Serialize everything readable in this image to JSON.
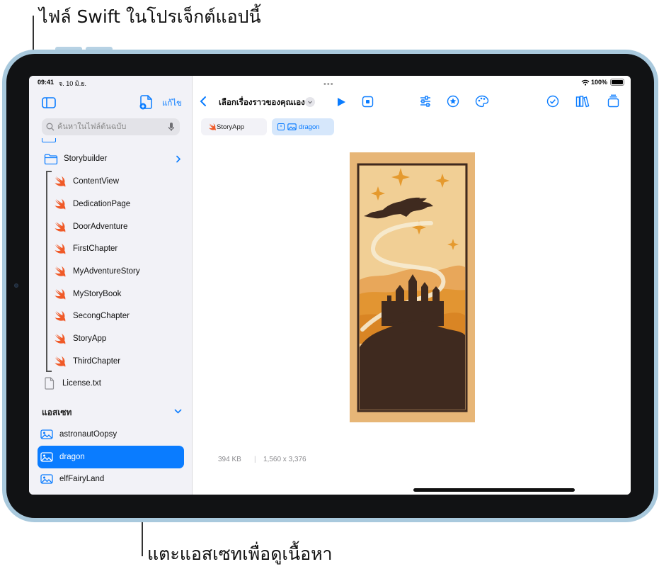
{
  "callouts": {
    "top": "ไฟล์ Swift ในโปรเจ็กต์แอปนี้",
    "bottom": "แตะแอสเซทเพื่อดูเนื้อหา"
  },
  "status_bar": {
    "time": "09:41",
    "date": "จ. 10 มิ.ย.",
    "battery": "100%"
  },
  "sidebar": {
    "edit_label": "แก้ไข",
    "search_placeholder": "ค้นหาในไฟล์ต้นฉบับ",
    "folder": "Storybuilder",
    "swift_files": [
      "ContentView",
      "DedicationPage",
      "DoorAdventure",
      "FirstChapter",
      "MyAdventureStory",
      "MyStoryBook",
      "SecongChapter",
      "StoryApp",
      "ThirdChapter"
    ],
    "text_file": "License.txt",
    "assets_header": "แอสเซท",
    "assets": [
      "astronautOopsy",
      "dragon",
      "elfFairyLand"
    ],
    "selected_asset": "dragon"
  },
  "toolbar": {
    "title": "เลือกเรื่องราวของคุณเอง"
  },
  "tabs": [
    "StoryApp",
    "dragon"
  ],
  "active_tab": "dragon",
  "image_meta": {
    "size": "394 KB",
    "separator": "|",
    "dimensions": "1,560 x 3,376"
  },
  "colors": {
    "accent": "#0a7cff",
    "swift_orange": "#f05a28",
    "device_frame": "#a9c9dd",
    "art_background": "#e7b677",
    "art_silhouette": "#3f2a1f"
  }
}
